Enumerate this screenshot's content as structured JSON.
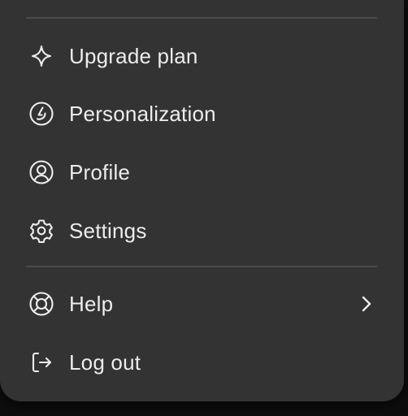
{
  "menu": {
    "items": [
      {
        "label": "Upgrade plan",
        "icon": "sparkle-icon"
      },
      {
        "label": "Personalization",
        "icon": "personalization-icon"
      },
      {
        "label": "Profile",
        "icon": "user-circle-icon"
      },
      {
        "label": "Settings",
        "icon": "gear-icon"
      },
      {
        "label": "Help",
        "icon": "lifebuoy-icon",
        "submenu_icon": "chevron-right-icon"
      },
      {
        "label": "Log out",
        "icon": "logout-icon"
      }
    ]
  },
  "colors": {
    "background": "#333333",
    "text": "#ececec",
    "divider": "#4b4b4b"
  }
}
